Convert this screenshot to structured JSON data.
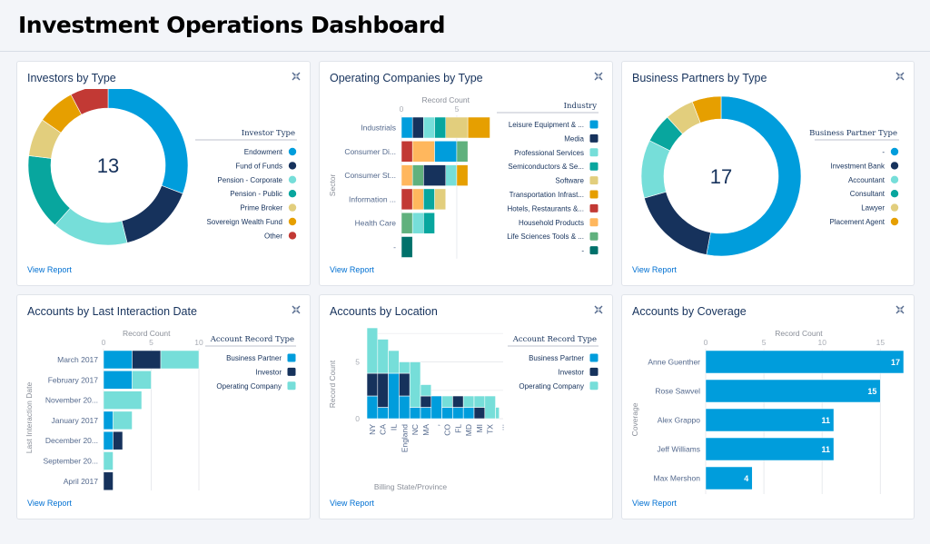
{
  "page": {
    "title": "Investment Operations Dashboard"
  },
  "colors": {
    "blue": "#009ddc",
    "navy": "#16325c",
    "aqua": "#76ded9",
    "teal": "#08a69e",
    "sand": "#e2ce7d",
    "gold": "#e69f00",
    "red": "#c23934",
    "peach": "#ffb75d",
    "green": "#60b17d",
    "darkteal": "#00716b"
  },
  "common": {
    "view_report": "View Report"
  },
  "chart_data": [
    {
      "id": "investors",
      "type": "pie",
      "variant": "donut",
      "title": "Investors by Type",
      "center_label": "13",
      "legend_title": "Investor Type",
      "legend_position": "right",
      "slices": [
        {
          "label": "Endowment",
          "value": 4,
          "color": "#009ddc"
        },
        {
          "label": "Fund of Funds",
          "value": 2,
          "color": "#16325c"
        },
        {
          "label": "Pension - Corporate",
          "value": 2,
          "color": "#76ded9"
        },
        {
          "label": "Pension - Public",
          "value": 2,
          "color": "#08a69e"
        },
        {
          "label": "Prime Broker",
          "value": 1,
          "color": "#e2ce7d"
        },
        {
          "label": "Sovereign Wealth Fund",
          "value": 1,
          "color": "#e69f00"
        },
        {
          "label": "Other",
          "value": 1,
          "color": "#c23934"
        }
      ]
    },
    {
      "id": "opco",
      "type": "bar",
      "orientation": "horizontal",
      "stacked": true,
      "title": "Operating Companies by Type",
      "xlabel": "Record Count",
      "ylabel": "Sector",
      "xlim": [
        0,
        8
      ],
      "xticks": [
        0,
        5
      ],
      "legend_title": "Industry",
      "legend_position": "right",
      "categories": [
        "Industrials",
        "Consumer Di...",
        "Consumer St...",
        "Information ...",
        "Health Care",
        "-"
      ],
      "series": [
        {
          "name": "Leisure Equipment & ...",
          "color": "#009ddc",
          "values": [
            1,
            2,
            0,
            0,
            0,
            0
          ]
        },
        {
          "name": "Media",
          "color": "#16325c",
          "values": [
            1,
            0,
            2,
            0,
            0,
            0
          ]
        },
        {
          "name": "Professional Services",
          "color": "#76ded9",
          "values": [
            1,
            0,
            1,
            0,
            1,
            0
          ]
        },
        {
          "name": "Semiconductors & Se...",
          "color": "#08a69e",
          "values": [
            1,
            0,
            0,
            1,
            1,
            0
          ]
        },
        {
          "name": "Software",
          "color": "#e2ce7d",
          "values": [
            2,
            0,
            0,
            1,
            0,
            0
          ]
        },
        {
          "name": "Transportation Infrast...",
          "color": "#e69f00",
          "values": [
            2,
            0,
            1,
            0,
            0,
            0
          ]
        },
        {
          "name": "Hotels, Restaurants &...",
          "color": "#c23934",
          "values": [
            0,
            1,
            0,
            1,
            0,
            0
          ]
        },
        {
          "name": "Household Products",
          "color": "#ffb75d",
          "values": [
            0,
            2,
            1,
            1,
            0,
            0
          ]
        },
        {
          "name": "Life Sciences Tools & ...",
          "color": "#60b17d",
          "values": [
            0,
            1,
            1,
            0,
            1,
            0
          ]
        },
        {
          "name": "-",
          "color": "#00716b",
          "values": [
            0,
            0,
            0,
            0,
            0,
            1
          ]
        }
      ],
      "stack_order": [
        [
          "Leisure Equipment & ...",
          "Media",
          "Professional Services",
          "Semiconductors & Se...",
          "Software",
          "Transportation Infrast..."
        ],
        [
          "Hotels, Restaurants &...",
          "Household Products",
          "Leisure Equipment & ...",
          "Life Sciences Tools & ..."
        ],
        [
          "Household Products",
          "Life Sciences Tools & ...",
          "Media",
          "Professional Services",
          "Transportation Infrast..."
        ],
        [
          "Hotels, Restaurants &...",
          "Household Products",
          "Semiconductors & Se...",
          "Software"
        ],
        [
          "Life Sciences Tools & ...",
          "Professional Services",
          "Semiconductors & Se..."
        ],
        [
          "-"
        ]
      ]
    },
    {
      "id": "partners",
      "type": "pie",
      "variant": "donut",
      "title": "Business Partners by Type",
      "center_label": "17",
      "legend_title": "Business Partner Type",
      "legend_position": "right",
      "slices": [
        {
          "label": "-",
          "value": 9,
          "color": "#009ddc"
        },
        {
          "label": "Investment Bank",
          "value": 3,
          "color": "#16325c"
        },
        {
          "label": "Accountant",
          "value": 2,
          "color": "#76ded9"
        },
        {
          "label": "Consultant",
          "value": 1,
          "color": "#08a69e"
        },
        {
          "label": "Lawyer",
          "value": 1,
          "color": "#e2ce7d"
        },
        {
          "label": "Placement Agent",
          "value": 1,
          "color": "#e69f00"
        }
      ]
    },
    {
      "id": "lastint",
      "type": "bar",
      "orientation": "horizontal",
      "stacked": true,
      "title": "Accounts by Last Interaction Date",
      "xlabel": "Record Count",
      "ylabel": "Last Interaction Date",
      "xlim": [
        0,
        10
      ],
      "xticks": [
        0,
        5,
        10
      ],
      "legend_title": "Account Record Type",
      "legend_position": "right",
      "categories": [
        "March 2017",
        "February 2017",
        "November 20...",
        "January 2017",
        "December 20...",
        "September 20...",
        "April 2017"
      ],
      "series": [
        {
          "name": "Business Partner",
          "color": "#009ddc",
          "values": [
            3,
            3,
            0,
            1,
            1,
            0,
            0
          ]
        },
        {
          "name": "Investor",
          "color": "#16325c",
          "values": [
            3,
            0,
            0,
            0,
            1,
            0,
            1
          ]
        },
        {
          "name": "Operating Company",
          "color": "#76ded9",
          "values": [
            4,
            2,
            4,
            2,
            0,
            1,
            0
          ]
        }
      ]
    },
    {
      "id": "location",
      "type": "bar",
      "orientation": "vertical",
      "stacked": true,
      "title": "Accounts by Location",
      "xlabel": "Billing State/Province",
      "ylabel": "Record Count",
      "ylim": [
        0,
        8
      ],
      "yticks": [
        0,
        5
      ],
      "legend_title": "Account Record Type",
      "legend_position": "right",
      "categories": [
        "NY",
        "CA",
        "IL",
        "England",
        "NC",
        "MA",
        ",",
        "CO",
        "FL",
        "MD",
        "MI",
        "TX",
        "..."
      ],
      "series": [
        {
          "name": "Business Partner",
          "color": "#009ddc",
          "values": [
            2,
            1,
            4,
            2,
            1,
            1,
            2,
            1,
            1,
            1,
            0,
            0,
            0
          ]
        },
        {
          "name": "Investor",
          "color": "#16325c",
          "values": [
            2,
            3,
            0,
            2,
            0,
            1,
            0,
            0,
            1,
            0,
            1,
            0,
            0
          ]
        },
        {
          "name": "Operating Company",
          "color": "#76ded9",
          "values": [
            4,
            3,
            2,
            1,
            4,
            1,
            0,
            1,
            0,
            1,
            1,
            2,
            1
          ]
        }
      ]
    },
    {
      "id": "coverage",
      "type": "bar",
      "orientation": "horizontal",
      "stacked": false,
      "title": "Accounts by Coverage",
      "xlabel": "Record Count",
      "ylabel": "Coverage",
      "xlim": [
        0,
        17
      ],
      "xticks": [
        0,
        5,
        10,
        15
      ],
      "color": "#009ddc",
      "categories": [
        "Anne Guenther",
        "Rose Sawvel",
        "Alex Grappo",
        "Jeff Williams",
        "Max Mershon"
      ],
      "values": [
        17,
        15,
        11,
        11,
        4
      ]
    }
  ]
}
